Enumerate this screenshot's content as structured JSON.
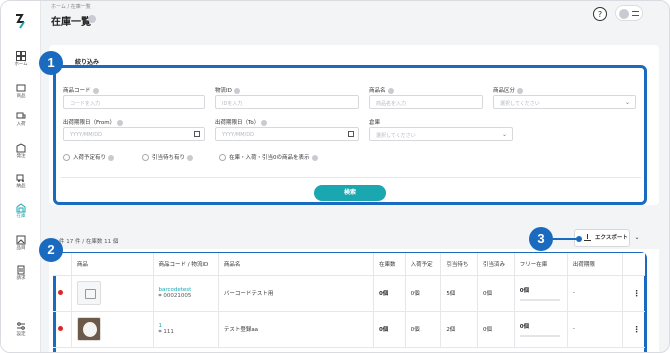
{
  "breadcrumb": "ホーム / 在庫一覧",
  "page_title": "在庫一覧",
  "sidebar": {
    "items": [
      {
        "label": "ホーム"
      },
      {
        "label": "商品"
      },
      {
        "label": "入荷"
      },
      {
        "label": "発注"
      },
      {
        "label": "納品"
      },
      {
        "label": "在庫"
      },
      {
        "label": "品目"
      },
      {
        "label": "請求"
      },
      {
        "label": "設定"
      }
    ]
  },
  "filter": {
    "title": "絞り込み",
    "fields": [
      {
        "label": "商品コード",
        "placeholder": "コードを入力"
      },
      {
        "label": "物流ID",
        "placeholder": "IDを入力"
      },
      {
        "label": "商品名",
        "placeholder": "商品名を入力"
      },
      {
        "label": "商品区分",
        "placeholder": "選択してください"
      },
      {
        "label": "出荷期限日（From）",
        "placeholder": "YYYY/MM/DD"
      },
      {
        "label": "出荷期限日（To）",
        "placeholder": "YYYY/MM/DD"
      },
      {
        "label": "倉庫",
        "placeholder": "選択してください"
      }
    ],
    "checkboxes": [
      {
        "label": "入荷予定有り"
      },
      {
        "label": "引当待ち有り"
      },
      {
        "label": "在庫・入荷・引当0の商品を表示"
      }
    ],
    "search_label": "検索"
  },
  "badges": [
    "1",
    "2",
    "3"
  ],
  "results": {
    "count_text": "件 17 件 / 在庫数 11 個",
    "export_label": "エクスポート"
  },
  "table": {
    "headers": [
      "",
      "商品",
      "商品コード / 物流ID",
      "商品名",
      "在庫数",
      "入荷予定",
      "引当待ち",
      "引当済み",
      "フリー在庫",
      "出荷期限",
      ""
    ],
    "rows": [
      {
        "code": "barcodetest",
        "logistics_id": "00021005",
        "name": "バーコードテスト用",
        "stock": "0個",
        "incoming": "0個",
        "waiting": "5個",
        "allocated": "0個",
        "free": "0個",
        "expiry": "-",
        "image": "placeholder"
      },
      {
        "code": "1",
        "logistics_id": "111",
        "name": "テスト登録aa",
        "stock": "0個",
        "incoming": "0個",
        "waiting": "2個",
        "allocated": "0個",
        "free": "0個",
        "expiry": "-",
        "image": "dog"
      }
    ]
  },
  "colors": {
    "accent": "#1aa7b0",
    "highlight": "#1a6bbf",
    "status": "#e02424"
  }
}
